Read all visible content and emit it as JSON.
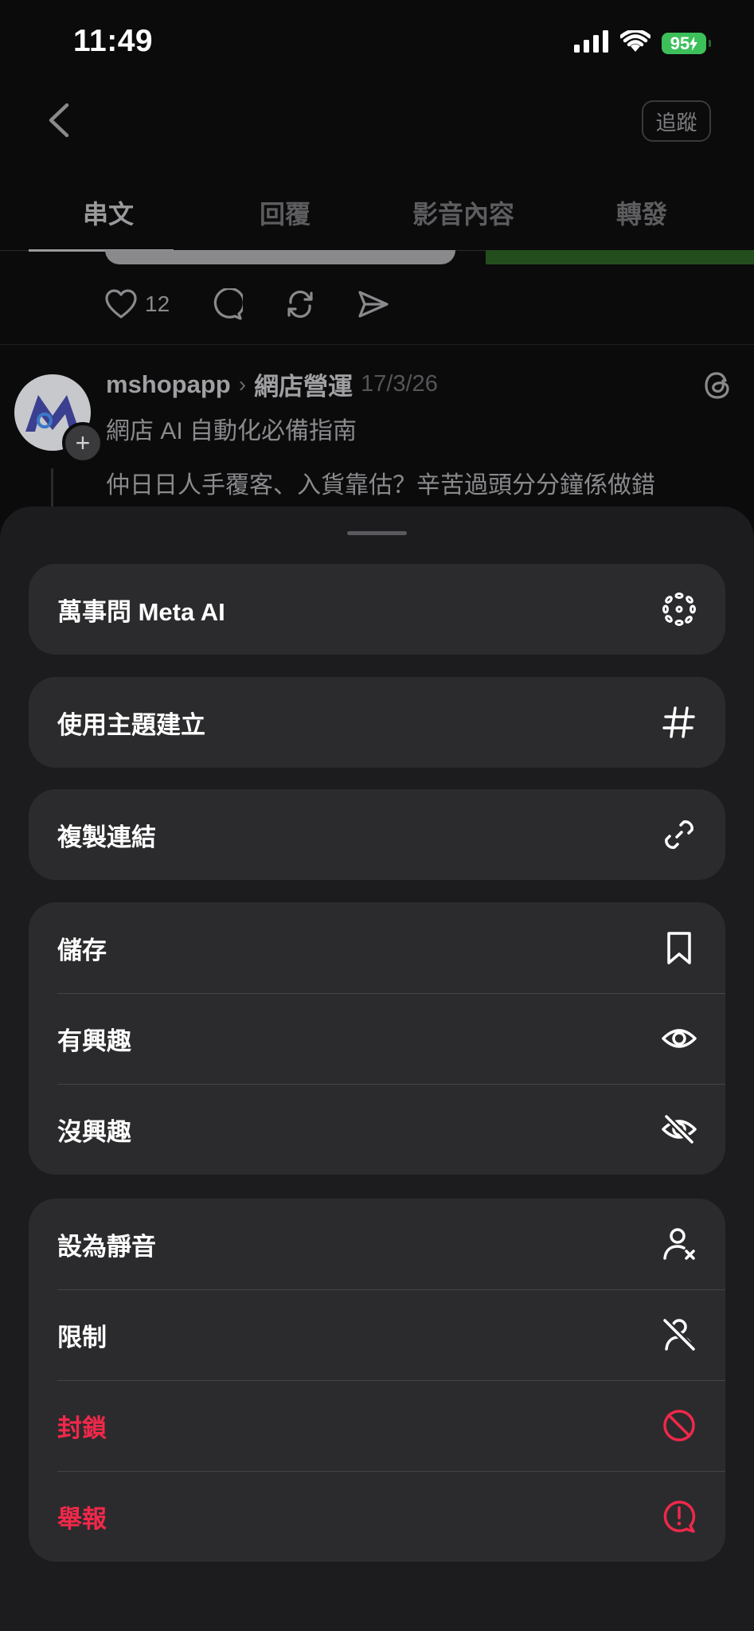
{
  "status_bar": {
    "time": "11:49",
    "battery": "95"
  },
  "header": {
    "follow_label": "追蹤"
  },
  "tabs": [
    {
      "label": "串文",
      "active": true
    },
    {
      "label": "回覆",
      "active": false
    },
    {
      "label": "影音內容",
      "active": false
    },
    {
      "label": "轉發",
      "active": false
    }
  ],
  "previous_post": {
    "like_count": "12"
  },
  "post": {
    "username": "mshopapp",
    "topic": "網店營運",
    "date": "17/3/26",
    "subtitle": "網店 AI 自動化必備指南",
    "body": "仲日日人手覆客、入貨靠估？辛苦過頭分分鐘係做錯"
  },
  "sheet": {
    "groups": [
      [
        {
          "label": "萬事問 Meta AI",
          "icon": "meta-ai-icon",
          "danger": false
        }
      ],
      [
        {
          "label": "使用主題建立",
          "icon": "hashtag-icon",
          "danger": false
        }
      ],
      [
        {
          "label": "複製連結",
          "icon": "link-icon",
          "danger": false
        }
      ],
      [
        {
          "label": "儲存",
          "icon": "bookmark-icon",
          "danger": false
        },
        {
          "label": "有興趣",
          "icon": "eye-icon",
          "danger": false
        },
        {
          "label": "沒興趣",
          "icon": "eye-slash-icon",
          "danger": false
        }
      ],
      [
        {
          "label": "設為靜音",
          "icon": "mute-user-icon",
          "danger": false
        },
        {
          "label": "限制",
          "icon": "restrict-user-icon",
          "danger": false
        },
        {
          "label": "封鎖",
          "icon": "block-icon",
          "danger": true
        },
        {
          "label": "舉報",
          "icon": "report-icon",
          "danger": true
        }
      ]
    ]
  },
  "colors": {
    "danger": "#f0284a",
    "sheet_bg": "#1c1c1e",
    "row_bg": "#2b2b2d",
    "battery": "#3dc05a"
  }
}
